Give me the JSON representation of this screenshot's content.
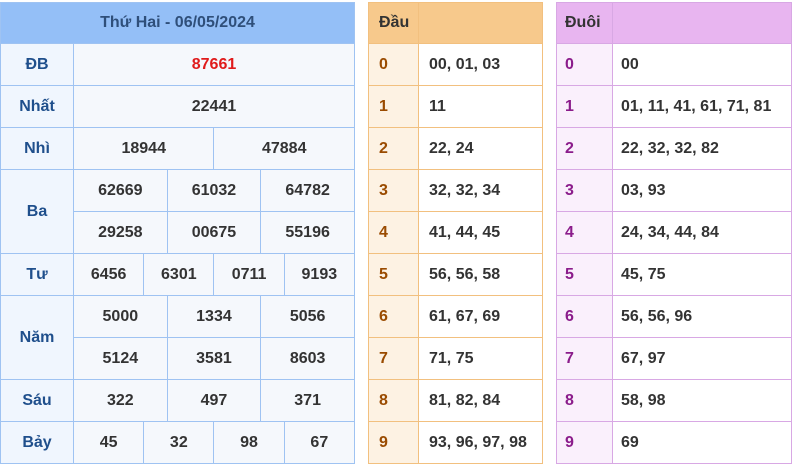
{
  "results": {
    "title": "Thứ Hai - 06/05/2024",
    "prizes": {
      "db": {
        "label": "ĐB",
        "values": [
          "87661"
        ]
      },
      "nhat": {
        "label": "Nhất",
        "values": [
          "22441"
        ]
      },
      "nhi": {
        "label": "Nhì",
        "values": [
          "18944",
          "47884"
        ]
      },
      "ba": {
        "label": "Ba",
        "values": [
          "62669",
          "61032",
          "64782",
          "29258",
          "00675",
          "55196"
        ]
      },
      "tu": {
        "label": "Tư",
        "values": [
          "6456",
          "6301",
          "0711",
          "9193"
        ]
      },
      "nam": {
        "label": "Năm",
        "values": [
          "5000",
          "1334",
          "5056",
          "5124",
          "3581",
          "8603"
        ]
      },
      "sau": {
        "label": "Sáu",
        "values": [
          "322",
          "497",
          "371"
        ]
      },
      "bay": {
        "label": "Bảy",
        "values": [
          "45",
          "32",
          "98",
          "67"
        ]
      }
    },
    "colors": {
      "header": "#94bff7",
      "special": "#e01b1b"
    }
  },
  "dau": {
    "header": "Đầu",
    "rows": [
      {
        "key": "0",
        "values": "00, 01, 03"
      },
      {
        "key": "1",
        "values": "11"
      },
      {
        "key": "2",
        "values": "22, 24"
      },
      {
        "key": "3",
        "values": "32, 32, 34"
      },
      {
        "key": "4",
        "values": "41, 44, 45"
      },
      {
        "key": "5",
        "values": "56, 56, 58"
      },
      {
        "key": "6",
        "values": "61, 67, 69"
      },
      {
        "key": "7",
        "values": "71, 75"
      },
      {
        "key": "8",
        "values": "81, 82, 84"
      },
      {
        "key": "9",
        "values": "93, 96, 97, 98"
      }
    ],
    "colors": {
      "header": "#f7c98c"
    }
  },
  "duoi": {
    "header": "Đuôi",
    "rows": [
      {
        "key": "0",
        "values": "00"
      },
      {
        "key": "1",
        "values": "01, 11, 41, 61, 71, 81"
      },
      {
        "key": "2",
        "values": "22, 32, 32, 82"
      },
      {
        "key": "3",
        "values": "03, 93"
      },
      {
        "key": "4",
        "values": "24, 34, 44, 84"
      },
      {
        "key": "5",
        "values": "45, 75"
      },
      {
        "key": "6",
        "values": "56, 56, 96"
      },
      {
        "key": "7",
        "values": "67, 97"
      },
      {
        "key": "8",
        "values": "58, 98"
      },
      {
        "key": "9",
        "values": "69"
      }
    ],
    "colors": {
      "header": "#e8b5f0"
    }
  }
}
